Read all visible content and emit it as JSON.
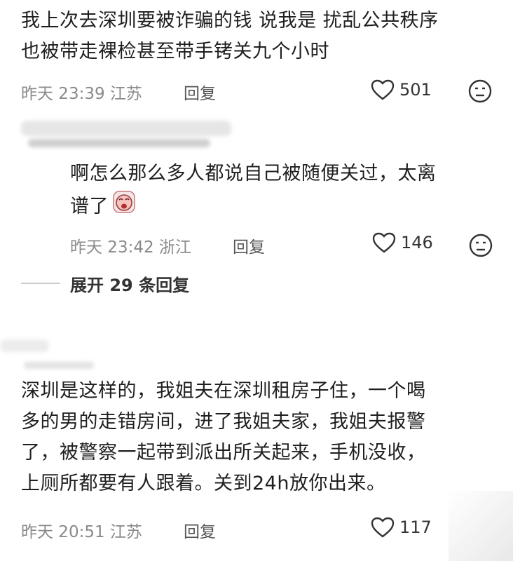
{
  "comments": [
    {
      "lines": [
        "我上次去深圳要被诈骗的钱 说我是 扰乱公共秩序",
        "也被带走裸检甚至带手铐关九个小时"
      ],
      "time": "昨天 23:39",
      "location": "江苏",
      "reply_label": "回复",
      "likes": "501"
    },
    {
      "lines": [
        "啊怎么那么多人都说自己被随便关过，太离",
        "谱了"
      ],
      "time": "昨天 23:42",
      "location": "浙江",
      "reply_label": "回复",
      "likes": "146",
      "expand_label": "展开 29 条回复"
    },
    {
      "lines": [
        "深圳是这样的，我姐夫在深圳租房子住，一个喝",
        "多的男的走错房间，进了我姐夫家，我姐夫报警",
        "了，被警察一起带到派出所关起来，手机没收，",
        "上厕所都要有人跟着。关到24h放你出来。"
      ],
      "time": "昨天 20:51",
      "location": "江苏",
      "reply_label": "回复",
      "likes": "117"
    }
  ],
  "icons": {
    "heart": "heart-icon",
    "dislike": "dislike-face-icon",
    "crying": "crying-emoji-icon"
  },
  "colors": {
    "meta": "#8a8a8a",
    "text": "#1f1f1f"
  }
}
